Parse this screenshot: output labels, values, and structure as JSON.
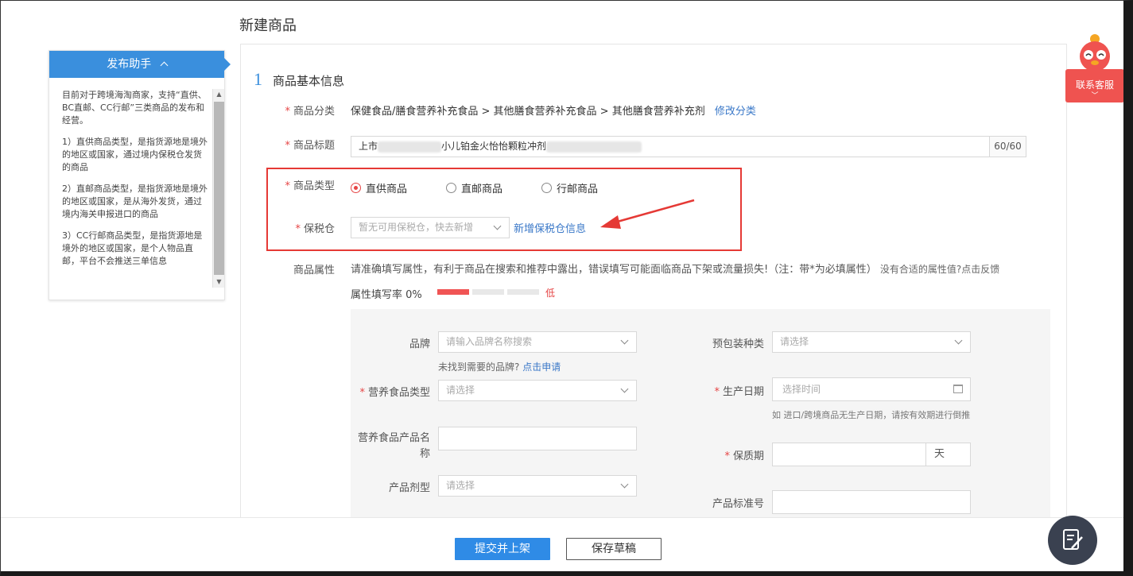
{
  "page": {
    "title": "新建商品"
  },
  "helper": {
    "title": "发布助手",
    "paragraphs": [
      "目前对于跨境海淘商家，支持“直供、BC直邮、CC行邮”三类商品的发布和经营。",
      "1）直供商品类型，是指货源地是境外的地区或国家，通过境内保税仓发货的商品",
      "2）直邮商品类型，是指货源地是境外的地区或国家，是从海外发货，通过境内海关申报进口的商品",
      "3）CC行邮商品类型，是指货源地是境外的地区或国家，是个人物品直邮，平台不会推送三单信息"
    ]
  },
  "section": {
    "number": "1",
    "title": "商品基本信息"
  },
  "category": {
    "label": "商品分类",
    "path": "保健食品/膳食营养补充食品 > 其他膳食营养补充食品 > 其他膳食营养补充剂",
    "modify": "修改分类"
  },
  "product_title": {
    "label": "商品标题",
    "prefix": "上市",
    "middle": "小儿铂金火怡怡颗粒冲剂",
    "count": "60/60"
  },
  "product_type": {
    "label": "商品类型",
    "options": [
      {
        "label": "直供商品",
        "selected": true
      },
      {
        "label": "直邮商品",
        "selected": false
      },
      {
        "label": "行邮商品",
        "selected": false
      }
    ]
  },
  "bonded": {
    "label": "保税仓",
    "placeholder": "暂无可用保税仓，快去新增",
    "add_link": "新增保税仓信息"
  },
  "attributes": {
    "label": "商品属性",
    "hint": "请准确填写属性，有利于商品在搜索和推荐中露出，错误填写可能面临商品下架或流量损失!（注：带*为必填属性）",
    "hint_small": "没有合适的属性值?",
    "feedback": "点击反馈",
    "rate_label": "属性填写率 0%",
    "rate_level": "低",
    "rate_color": "#f05454"
  },
  "fields": {
    "brand": {
      "label": "品牌",
      "placeholder": "请输入品牌名称搜索",
      "hint": "未找到需要的品牌?",
      "apply": "点击申请"
    },
    "package": {
      "label": "预包装种类",
      "placeholder": "请选择"
    },
    "food_type": {
      "label": "营养食品类型",
      "placeholder": "请选择"
    },
    "prod_date": {
      "label": "生产日期",
      "placeholder": "选择时间",
      "hint": "如 进口/跨境商品无生产日期，请按有效期进行倒推"
    },
    "product_name": {
      "label": "营养食品产品名称"
    },
    "shelf_life": {
      "label": "保质期",
      "unit": "天"
    },
    "dosage": {
      "label": "产品剂型",
      "placeholder": "请选择"
    },
    "standard_no": {
      "label": "产品标准号"
    }
  },
  "actions": {
    "submit": "提交并上架",
    "draft": "保存草稿"
  },
  "service": {
    "label": "联系客服"
  },
  "colors": {
    "accent": "#2f8be6",
    "required": "#e64545",
    "highlight": "#e53935"
  }
}
